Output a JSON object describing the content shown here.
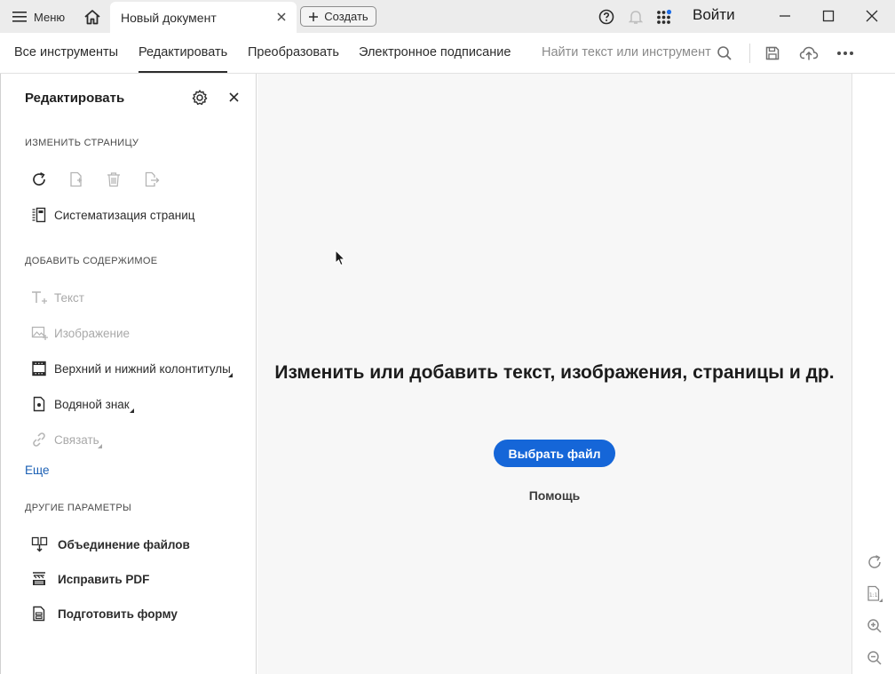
{
  "titlebar": {
    "menu_label": "Меню",
    "doc_tab_label": "Новый документ",
    "create_label": "Создать",
    "login_label": "Войти"
  },
  "toolbar": {
    "tabs": [
      {
        "label": "Все инструменты"
      },
      {
        "label": "Редактировать"
      },
      {
        "label": "Преобразовать"
      },
      {
        "label": "Электронное подписание"
      }
    ],
    "active_tab": "Редактировать",
    "search_placeholder": "Найти текст или инструмент"
  },
  "panel": {
    "title": "Редактировать",
    "sections": {
      "change_page": "ИЗМЕНИТЬ СТРАНИЦУ",
      "add_content": "ДОБАВИТЬ СОДЕРЖИМОЕ",
      "other": "ДРУГИЕ ПАРАМЕТРЫ"
    },
    "organize_label": "Систематизация страниц",
    "add_items": [
      {
        "label": "Текст",
        "enabled": false
      },
      {
        "label": "Изображение",
        "enabled": false
      },
      {
        "label": "Верхний и нижний колонтитулы",
        "enabled": true
      },
      {
        "label": "Водяной знак",
        "enabled": true
      },
      {
        "label": "Связать",
        "enabled": false
      }
    ],
    "more_label": "Еще",
    "other_items": [
      {
        "label": "Объединение файлов"
      },
      {
        "label": "Исправить PDF"
      },
      {
        "label": "Подготовить форму"
      }
    ]
  },
  "content": {
    "headline": "Изменить или добавить текст, изображения, страницы и др.",
    "choose_button": "Выбрать файл",
    "help_link": "Помощь"
  },
  "colors": {
    "accent": "#1566d8",
    "link": "#1a5fb4",
    "titlebar_bg": "#ececec",
    "content_bg": "#f7f7f7"
  }
}
